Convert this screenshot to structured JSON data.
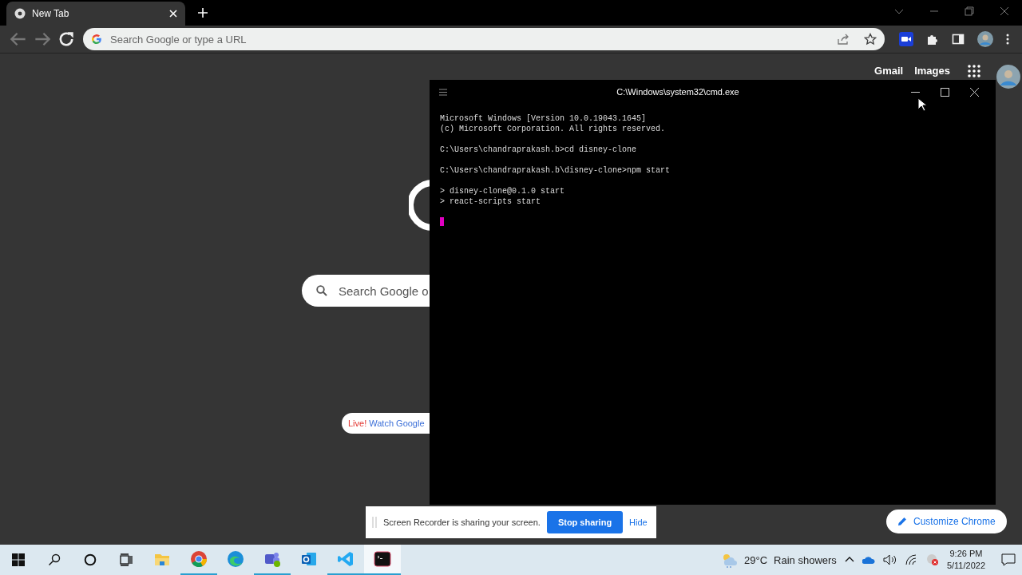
{
  "browser": {
    "tabs": [
      {
        "title": "New Tab",
        "selected": true
      }
    ],
    "address_bar": {
      "placeholder": "Search Google or type a URL"
    },
    "header_links": [
      "Gmail",
      "Images"
    ],
    "search_box": {
      "placeholder": "Search Google o"
    },
    "doodle_chip": {
      "badge": "Live!",
      "link": "Watch Google"
    },
    "customize_button": "Customize Chrome"
  },
  "terminal": {
    "title": "C:\\Windows\\system32\\cmd.exe",
    "blocks": [
      [
        "Microsoft Windows [Version 10.0.19043.1645]",
        "(c) Microsoft Corporation. All rights reserved."
      ],
      [
        "C:\\Users\\chandraprakash.b>cd disney-clone"
      ],
      [
        "C:\\Users\\chandraprakash.b\\disney-clone>npm start"
      ],
      [
        "> disney-clone@0.1.0 start",
        "> react-scripts start"
      ]
    ]
  },
  "share_bar": {
    "message": "Screen Recorder is sharing your screen.",
    "stop_button": "Stop sharing",
    "hide_link": "Hide"
  },
  "taskbar": {
    "apps": [
      {
        "kind": "explorer",
        "running": false,
        "selected": false
      },
      {
        "kind": "chrome",
        "running": true,
        "selected": false
      },
      {
        "kind": "edge",
        "running": false,
        "selected": false
      },
      {
        "kind": "teams",
        "running": true,
        "selected": false
      },
      {
        "kind": "outlook",
        "running": false,
        "selected": false
      },
      {
        "kind": "vscode",
        "running": true,
        "selected": false
      },
      {
        "kind": "terminal",
        "running": true,
        "selected": true
      }
    ],
    "weather": {
      "temperature": "29°C",
      "condition": "Rain showers"
    },
    "clock": {
      "time": "9:26 PM",
      "date": "5/11/2022"
    }
  }
}
